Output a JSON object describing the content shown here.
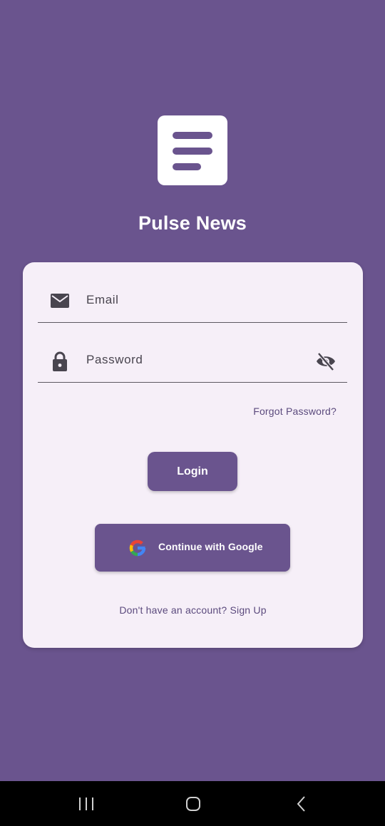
{
  "app": {
    "title": "Pulse News",
    "logo_icon": "menu-lines-icon"
  },
  "form": {
    "email": {
      "icon": "mail-icon",
      "placeholder": "Email",
      "value": ""
    },
    "password": {
      "icon": "lock-icon",
      "placeholder": "Password",
      "value": "",
      "toggle_icon": "eye-off-icon"
    },
    "forgot_password": "Forgot Password?",
    "login_label": "Login",
    "google_label": "Continue with Google",
    "google_icon": "google-g-icon",
    "signup_text": "Don't have an account? Sign Up"
  },
  "navigation_bar": {
    "buttons": [
      "recent-apps-icon",
      "home-icon",
      "back-icon"
    ]
  },
  "colors": {
    "primary": "#6a548e",
    "card_background": "#f6eff8",
    "link_text": "#5b4a7d",
    "field_text": "#49454f"
  }
}
